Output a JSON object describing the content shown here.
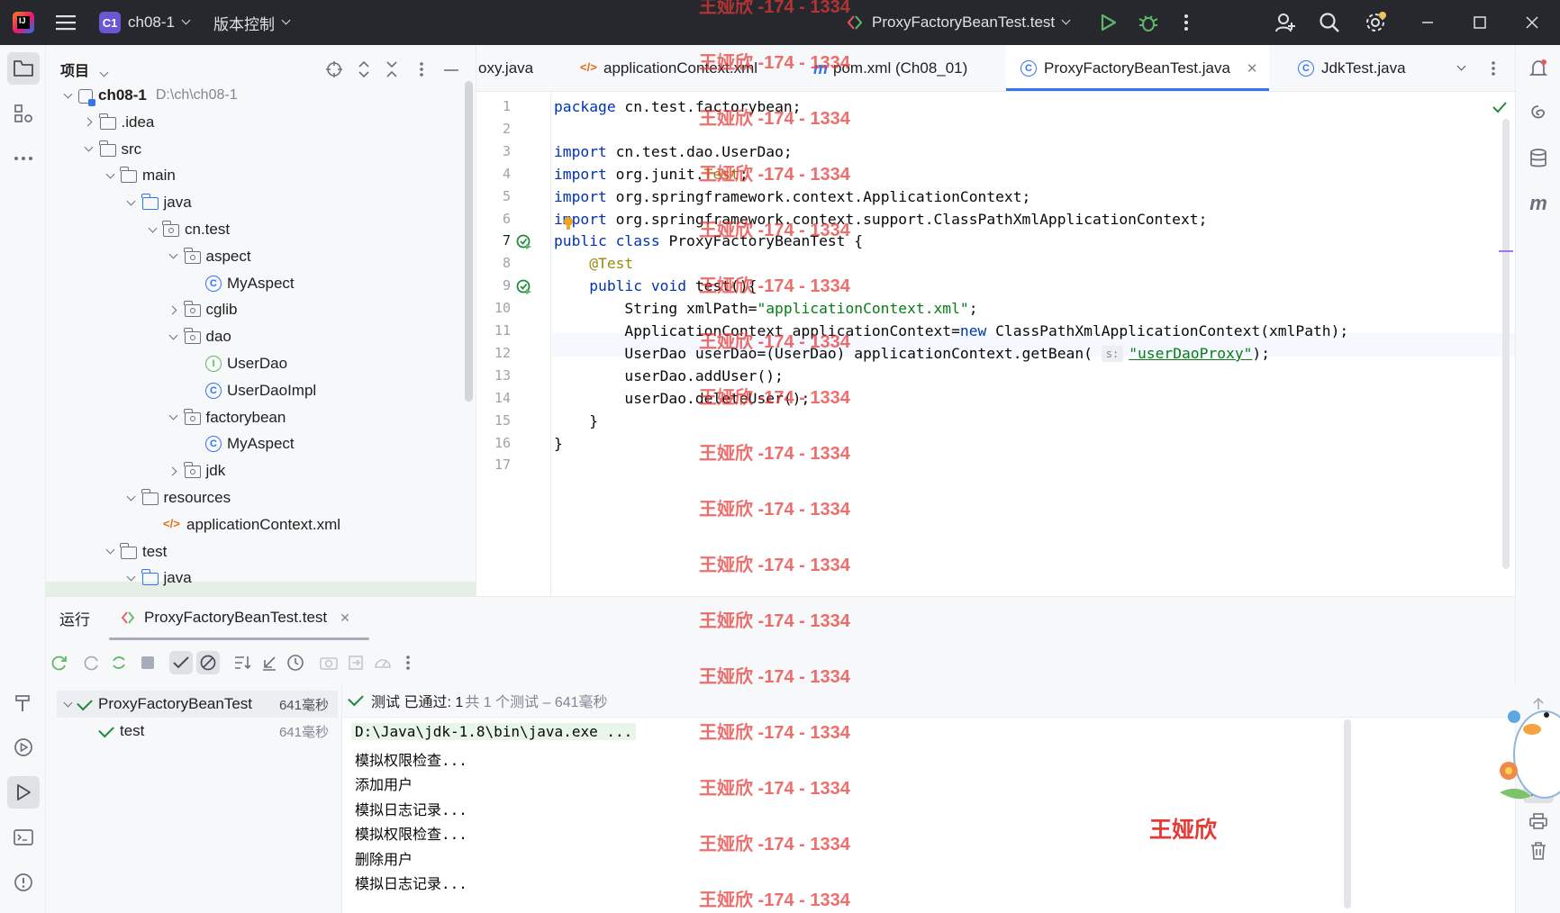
{
  "titlebar": {
    "project_badge": "C1",
    "project_name": "ch08-1",
    "vcs_label": "版本控制",
    "run_config": "ProxyFactoryBeanTest.test"
  },
  "project_panel": {
    "title": "项目",
    "tree": [
      {
        "label": "ch08-1",
        "sub": "D:\\ch\\ch08-1",
        "type": "module",
        "depth": 0,
        "state": "open"
      },
      {
        "label": ".idea",
        "type": "folder",
        "depth": 1,
        "state": "closed"
      },
      {
        "label": "src",
        "type": "folder",
        "depth": 1,
        "state": "open"
      },
      {
        "label": "main",
        "type": "folder",
        "depth": 2,
        "state": "open"
      },
      {
        "label": "java",
        "type": "folder-blue",
        "depth": 3,
        "state": "open"
      },
      {
        "label": "cn.test",
        "type": "package",
        "depth": 4,
        "state": "open"
      },
      {
        "label": "aspect",
        "type": "package",
        "depth": 5,
        "state": "open"
      },
      {
        "label": "MyAspect",
        "type": "class",
        "depth": 6,
        "state": "none"
      },
      {
        "label": "cglib",
        "type": "package",
        "depth": 5,
        "state": "closed"
      },
      {
        "label": "dao",
        "type": "package",
        "depth": 5,
        "state": "open"
      },
      {
        "label": "UserDao",
        "type": "interface",
        "depth": 6,
        "state": "none"
      },
      {
        "label": "UserDaoImpl",
        "type": "class",
        "depth": 6,
        "state": "none"
      },
      {
        "label": "factorybean",
        "type": "package",
        "depth": 5,
        "state": "open"
      },
      {
        "label": "MyAspect",
        "type": "class",
        "depth": 6,
        "state": "none"
      },
      {
        "label": "jdk",
        "type": "package",
        "depth": 5,
        "state": "closed"
      },
      {
        "label": "resources",
        "type": "folder",
        "depth": 3,
        "state": "open"
      },
      {
        "label": "applicationContext.xml",
        "type": "xml",
        "depth": 4,
        "state": "none"
      },
      {
        "label": "test",
        "type": "folder",
        "depth": 2,
        "state": "open"
      },
      {
        "label": "java",
        "type": "folder-blue",
        "depth": 3,
        "state": "open"
      }
    ]
  },
  "editor_tabs": [
    {
      "label": "oxy.java",
      "icon": "java-file-icon",
      "active": false
    },
    {
      "label": "applicationContext.xml",
      "icon": "xml-icon",
      "active": false
    },
    {
      "label": "pom.xml (Ch08_01)",
      "icon": "maven-icon",
      "active": false
    },
    {
      "label": "ProxyFactoryBeanTest.java",
      "icon": "class-icon",
      "active": true
    },
    {
      "label": "JdkTest.java",
      "icon": "class-icon",
      "active": false
    }
  ],
  "editor": {
    "current_line": 7,
    "lines": [
      [
        {
          "t": "package",
          "c": "kw"
        },
        {
          "t": " cn.test.factorybean;"
        }
      ],
      [],
      [
        {
          "t": "import",
          "c": "kw"
        },
        {
          "t": " cn.test.dao.UserDao;"
        }
      ],
      [
        {
          "t": "import",
          "c": "kw"
        },
        {
          "t": " org.junit."
        },
        {
          "t": "Test",
          "c": "ann"
        },
        {
          "t": ";"
        }
      ],
      [
        {
          "t": "import",
          "c": "kw"
        },
        {
          "t": " org.springframework.context.ApplicationContext;"
        }
      ],
      [
        {
          "t": "import",
          "c": "kw"
        },
        {
          "t": " org.springframework.context.support.ClassPathXmlApplicationContext;"
        }
      ],
      [
        {
          "t": "public class",
          "c": "kw"
        },
        {
          "t": " ProxyFactoryBeanTest {"
        }
      ],
      [
        {
          "t": "    "
        },
        {
          "t": "@Test",
          "c": "ann"
        }
      ],
      [
        {
          "t": "    "
        },
        {
          "t": "public void",
          "c": "kw"
        },
        {
          "t": " test(){"
        }
      ],
      [
        {
          "t": "        String xmlPath="
        },
        {
          "t": "\"applicationContext.xml\"",
          "c": "str"
        },
        {
          "t": ";"
        }
      ],
      [
        {
          "t": "        ApplicationContext applicationContext="
        },
        {
          "t": "new",
          "c": "kw"
        },
        {
          "t": " ClassPathXmlApplicationContext(xmlPath);"
        }
      ],
      [
        {
          "t": "        UserDao userDao=(UserDao) applicationContext.getBean( "
        },
        {
          "t": "s:",
          "c": "hint"
        },
        {
          "t": "\"userDaoProxy\"",
          "c": "str"
        },
        {
          "t": ");"
        }
      ],
      [
        {
          "t": "        userDao.addUser();"
        }
      ],
      [
        {
          "t": "        userDao.deleteUser();"
        }
      ],
      [
        {
          "t": "    }"
        }
      ],
      [
        {
          "t": "}"
        }
      ],
      []
    ]
  },
  "run_panel": {
    "title": "运行",
    "tab_label": "ProxyFactoryBeanTest.test",
    "status_text": "测试 已通过: 1",
    "status_detail": "共 1 个测试 – 641毫秒",
    "tree": [
      {
        "label": "ProxyFactoryBeanTest",
        "time": "641毫秒",
        "depth": 0
      },
      {
        "label": "test",
        "time": "641毫秒",
        "depth": 1
      }
    ],
    "console": [
      "D:\\Java\\jdk-1.8\\bin\\java.exe ...",
      "模拟权限检查...",
      "添加用户",
      "模拟日志记录...",
      "模拟权限检查...",
      "删除用户",
      "模拟日志记录..."
    ]
  },
  "watermark": {
    "repeat_text": "王娅欣 -174 - 1334",
    "signature": "王娅欣"
  },
  "colors": {
    "titlebar_bg": "#27282e",
    "accent": "#3574f0",
    "keyword": "#0033b3",
    "string": "#067d17",
    "annotation": "#9e880d",
    "success": "#208a3c",
    "watermark": "#e53935"
  }
}
